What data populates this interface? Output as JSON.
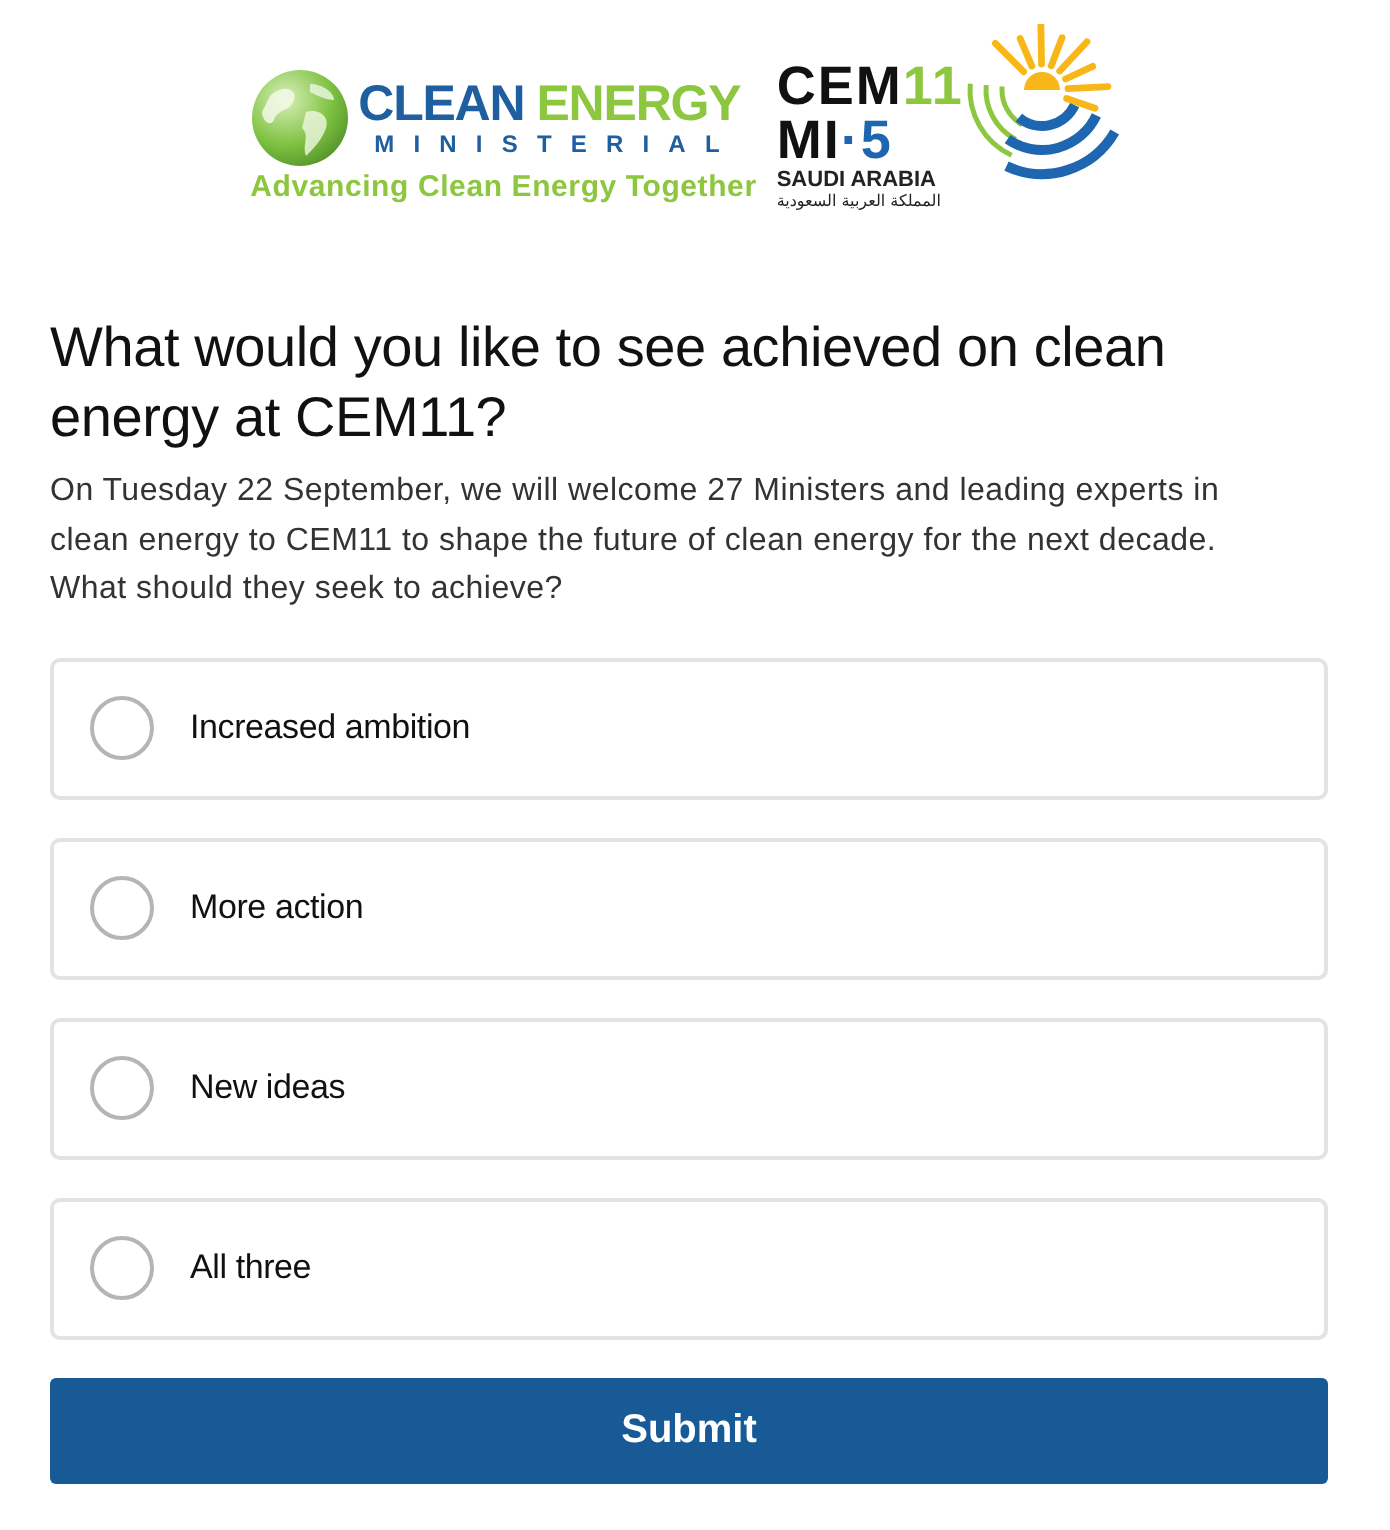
{
  "logo": {
    "ministerial": {
      "title_parts": [
        "CLEAN",
        "ENERGY"
      ],
      "subtitle": "MINISTERIAL",
      "tagline": "Advancing Clean Energy Together"
    },
    "event": {
      "name_parts": [
        "CEM",
        "11"
      ],
      "second_line_parts": [
        "MI",
        "·5"
      ],
      "country": "SAUDI ARABIA",
      "country_arabic": "المملكة العربية السعودية"
    }
  },
  "question": {
    "title": "What would you like to see achieved on clean energy at CEM11?",
    "description": "On Tuesday 22 September, we will welcome 27 Ministers and leading experts in clean energy to CEM11 to shape the future of clean energy for the next decade. What should they seek to achieve?"
  },
  "options": [
    {
      "label": "Increased ambition",
      "selected": false
    },
    {
      "label": "More action",
      "selected": false
    },
    {
      "label": "New ideas",
      "selected": false
    },
    {
      "label": "All three",
      "selected": false
    }
  ],
  "submit": {
    "label": "Submit"
  }
}
